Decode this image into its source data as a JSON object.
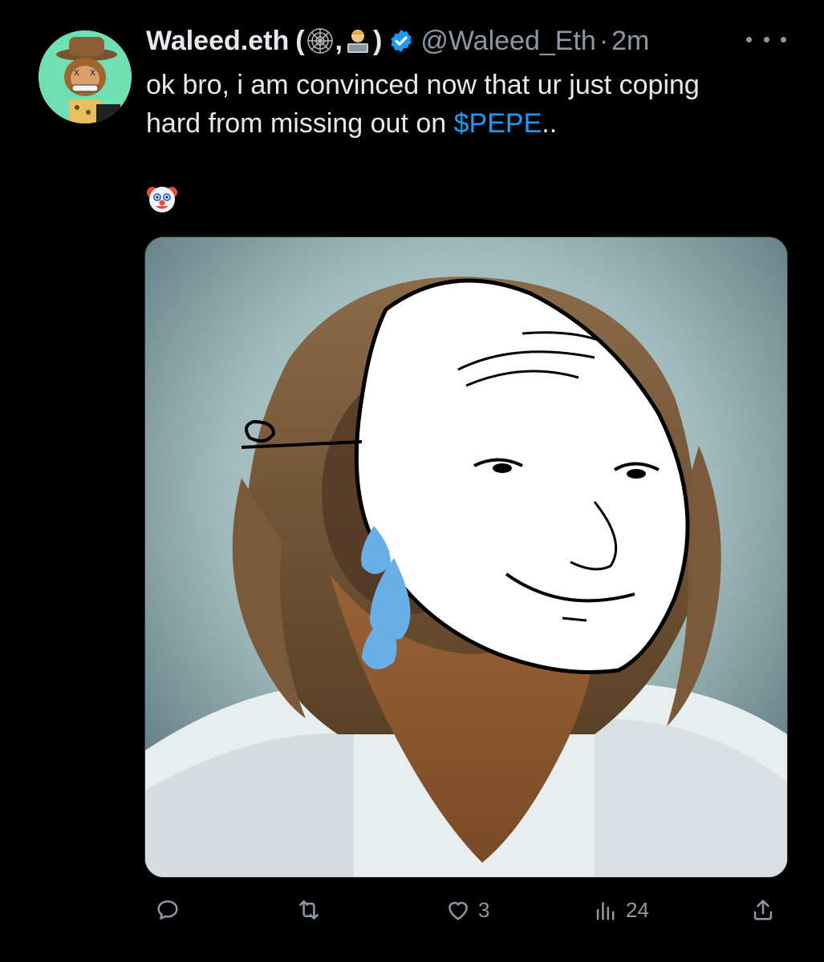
{
  "tweet": {
    "display_name": "Waleed.eth",
    "name_suffix_open": "(",
    "name_suffix_sep": ",",
    "name_suffix_close": ")",
    "name_emojis": [
      "spider-web-emoji",
      "technologist-emoji"
    ],
    "handle": "@Waleed_Eth",
    "separator": "·",
    "timestamp": "2m",
    "text_line1": "ok bro, i am convinced now that ur just coping",
    "text_line2_before": "hard from missing out on ",
    "cashtag": "$PEPE",
    "text_line2_after": "..",
    "trailing_emoji": "clown-face-emoji",
    "media_description_icon": "photo"
  },
  "actions": {
    "reply_count": "",
    "retweet_count": "",
    "like_count": "3",
    "views_count": "24"
  },
  "colors": {
    "background": "#000000",
    "text": "#e7e9ea",
    "muted": "#8b98a5",
    "link": "#1d9bf0",
    "verified": "#1d9bf0"
  }
}
